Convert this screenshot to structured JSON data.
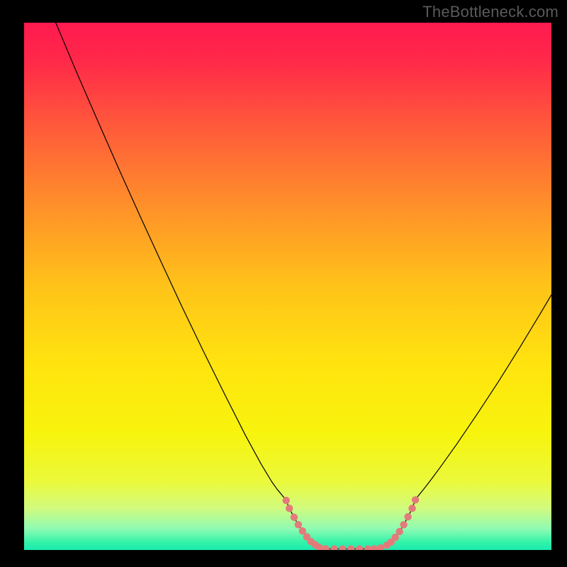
{
  "watermark": {
    "text": "TheBottleneck.com"
  },
  "chart_data": {
    "type": "line",
    "title": "",
    "xlabel": "",
    "ylabel": "",
    "xlim": [
      0,
      1000
    ],
    "ylim": [
      0,
      1000
    ],
    "grid": false,
    "curve": {
      "name": "bottleneck-curve",
      "color": "#000000",
      "points": [
        {
          "x": 60,
          "y": 1000
        },
        {
          "x": 100,
          "y": 905
        },
        {
          "x": 140,
          "y": 813
        },
        {
          "x": 180,
          "y": 722
        },
        {
          "x": 220,
          "y": 633
        },
        {
          "x": 260,
          "y": 546
        },
        {
          "x": 300,
          "y": 460
        },
        {
          "x": 340,
          "y": 377
        },
        {
          "x": 380,
          "y": 296
        },
        {
          "x": 420,
          "y": 217
        },
        {
          "x": 450,
          "y": 162
        },
        {
          "x": 470,
          "y": 129
        },
        {
          "x": 480,
          "y": 115
        },
        {
          "x": 490,
          "y": 103
        },
        {
          "x": 497,
          "y": 94
        },
        {
          "x": 503,
          "y": 79
        },
        {
          "x": 512,
          "y": 62
        },
        {
          "x": 520,
          "y": 48
        },
        {
          "x": 528,
          "y": 36
        },
        {
          "x": 536,
          "y": 25
        },
        {
          "x": 544,
          "y": 16
        },
        {
          "x": 552,
          "y": 10
        },
        {
          "x": 560,
          "y": 5
        },
        {
          "x": 572,
          "y": 2
        },
        {
          "x": 588,
          "y": 2
        },
        {
          "x": 604,
          "y": 2
        },
        {
          "x": 620,
          "y": 2
        },
        {
          "x": 636,
          "y": 2
        },
        {
          "x": 652,
          "y": 2
        },
        {
          "x": 664,
          "y": 2
        },
        {
          "x": 676,
          "y": 4
        },
        {
          "x": 688,
          "y": 9
        },
        {
          "x": 696,
          "y": 15
        },
        {
          "x": 704,
          "y": 24
        },
        {
          "x": 712,
          "y": 35
        },
        {
          "x": 720,
          "y": 48
        },
        {
          "x": 728,
          "y": 63
        },
        {
          "x": 736,
          "y": 79
        },
        {
          "x": 742,
          "y": 95
        },
        {
          "x": 747,
          "y": 102
        },
        {
          "x": 756,
          "y": 113
        },
        {
          "x": 770,
          "y": 131
        },
        {
          "x": 790,
          "y": 158
        },
        {
          "x": 820,
          "y": 200
        },
        {
          "x": 860,
          "y": 259
        },
        {
          "x": 900,
          "y": 320
        },
        {
          "x": 940,
          "y": 384
        },
        {
          "x": 980,
          "y": 450
        },
        {
          "x": 1000,
          "y": 484
        }
      ]
    },
    "threshold_dots": {
      "name": "green-band-entry-dots",
      "color": "#e37b7a",
      "radius": 6.5,
      "left_segment": [
        {
          "x": 497,
          "y": 94
        },
        {
          "x": 503,
          "y": 79
        },
        {
          "x": 512,
          "y": 62
        },
        {
          "x": 520,
          "y": 48
        },
        {
          "x": 528,
          "y": 36
        },
        {
          "x": 536,
          "y": 25
        },
        {
          "x": 544,
          "y": 16
        },
        {
          "x": 552,
          "y": 10
        },
        {
          "x": 560,
          "y": 5
        }
      ],
      "floor_segment": [
        {
          "x": 572,
          "y": 2
        },
        {
          "x": 588,
          "y": 2
        },
        {
          "x": 604,
          "y": 2
        },
        {
          "x": 620,
          "y": 2
        },
        {
          "x": 636,
          "y": 2
        },
        {
          "x": 652,
          "y": 2
        },
        {
          "x": 664,
          "y": 2
        }
      ],
      "right_segment": [
        {
          "x": 676,
          "y": 4
        },
        {
          "x": 688,
          "y": 9
        },
        {
          "x": 696,
          "y": 15
        },
        {
          "x": 704,
          "y": 24
        },
        {
          "x": 712,
          "y": 35
        },
        {
          "x": 720,
          "y": 48
        },
        {
          "x": 728,
          "y": 63
        },
        {
          "x": 736,
          "y": 79
        },
        {
          "x": 742,
          "y": 95
        }
      ]
    },
    "background_gradient": {
      "stops": [
        {
          "offset": 0.0,
          "color": "#ff1a4f"
        },
        {
          "offset": 0.07,
          "color": "#ff2849"
        },
        {
          "offset": 0.2,
          "color": "#ff5b3a"
        },
        {
          "offset": 0.35,
          "color": "#ff9129"
        },
        {
          "offset": 0.5,
          "color": "#ffc319"
        },
        {
          "offset": 0.65,
          "color": "#ffe40f"
        },
        {
          "offset": 0.78,
          "color": "#f7f40d"
        },
        {
          "offset": 0.87,
          "color": "#ebf93b"
        },
        {
          "offset": 0.92,
          "color": "#d2fb7e"
        },
        {
          "offset": 0.96,
          "color": "#8efbb3"
        },
        {
          "offset": 0.985,
          "color": "#34f3a8"
        },
        {
          "offset": 1.0,
          "color": "#1aebb0"
        }
      ]
    }
  }
}
